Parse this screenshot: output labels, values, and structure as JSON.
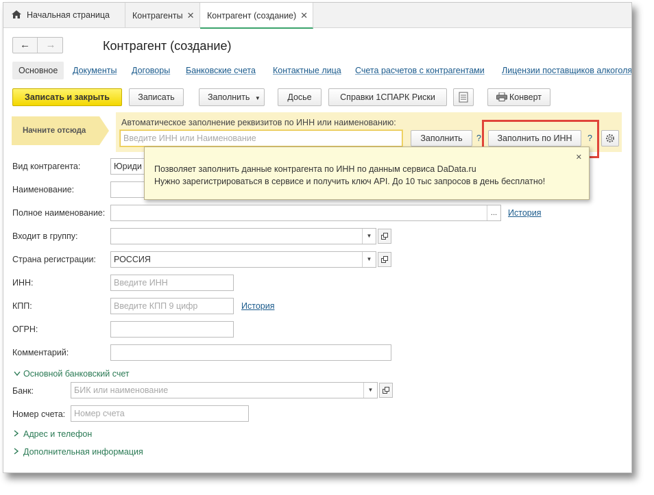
{
  "tabs": [
    {
      "label": "Начальная страница",
      "icon": "home-icon"
    },
    {
      "label": "Контрагенты",
      "close": "✕"
    },
    {
      "label": "Контрагент (создание)",
      "close": "✕",
      "active": true
    }
  ],
  "header": {
    "back": "←",
    "forward": "→",
    "title": "Контрагент (создание)"
  },
  "sections": [
    "Основное",
    "Документы",
    "Договоры",
    "Банковские счета",
    "Контактные лица",
    "Счета расчетов с контрагентами",
    "Лицензии поставщиков алкоголя"
  ],
  "toolbar": {
    "save_close": "Записать и закрыть",
    "save": "Записать",
    "fill": "Заполнить",
    "dossier": "Досье",
    "spark": "Справки 1СПАРК Риски",
    "envelope": "Конверт"
  },
  "start_here": "Начните отсюда",
  "autofill": {
    "label": "Автоматическое заполнение реквизитов по ИНН или наименованию:",
    "placeholder": "Введите ИНН или Наименование",
    "fill_button": "Заполнить",
    "fill_inn_button": "Заполнить по ИНН",
    "help": "?"
  },
  "tooltip": {
    "line1": "Позволяет заполнить данные контрагента по ИНН по данным сервиса DaData.ru",
    "line2": "Нужно зарегистрироваться в сервисе  и получить ключ API. До 10 тыс запросов в день бесплатно!",
    "close": "✕"
  },
  "form": {
    "kind_label": "Вид контрагента:",
    "kind_value": "Юриди",
    "name_label": "Наименование:",
    "full_name_label": "Полное наименование:",
    "full_name_more": "...",
    "history": "История",
    "group_label": "Входит в группу:",
    "country_label": "Страна регистрации:",
    "country_value": "РОССИЯ",
    "inn_label": "ИНН:",
    "inn_placeholder": "Введите ИНН",
    "kpp_label": "КПП:",
    "kpp_placeholder": "Введите КПП 9 цифр",
    "ogrn_label": "ОГРН:",
    "comment_label": "Комментарий:"
  },
  "bank": {
    "group_title": "Основной банковский счет",
    "bank_label": "Банк:",
    "bank_placeholder": "БИК или наименование",
    "account_label": "Номер счета:",
    "account_placeholder": "Номер счета"
  },
  "collapsed_groups": [
    "Адрес и телефон",
    "Дополнительная информация"
  ]
}
